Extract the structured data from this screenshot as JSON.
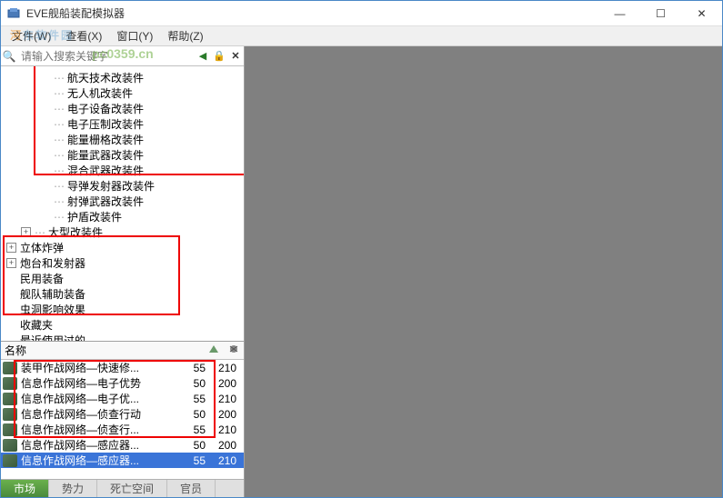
{
  "window": {
    "title": "EVE舰船装配模拟器",
    "minimize": "—",
    "maximize": "☐",
    "close": "✕"
  },
  "menu": {
    "file": "文件(W)",
    "view": "查看(X)",
    "window": "窗口(Y)",
    "help": "帮助(Z)"
  },
  "watermark": {
    "main_a": "河",
    "main_b": "东软件园",
    "url": "pc0359.cn"
  },
  "search": {
    "placeholder": "请输入搜索关键字"
  },
  "toolbar": {
    "left": "◀",
    "lock": "🔒",
    "close": "✕"
  },
  "tree": [
    {
      "indent": 2,
      "label": "航天技术改装件",
      "expander": ""
    },
    {
      "indent": 2,
      "label": "无人机改装件",
      "expander": ""
    },
    {
      "indent": 2,
      "label": "电子设备改装件",
      "expander": ""
    },
    {
      "indent": 2,
      "label": "电子压制改装件",
      "expander": ""
    },
    {
      "indent": 2,
      "label": "能量栅格改装件",
      "expander": ""
    },
    {
      "indent": 2,
      "label": "能量武器改装件",
      "expander": ""
    },
    {
      "indent": 2,
      "label": "混合武器改装件",
      "expander": ""
    },
    {
      "indent": 2,
      "label": "导弹发射器改装件",
      "expander": ""
    },
    {
      "indent": 2,
      "label": "射弹武器改装件",
      "expander": ""
    },
    {
      "indent": 2,
      "label": "护盾改装件",
      "expander": ""
    },
    {
      "indent": 1,
      "label": "大型改装件",
      "expander": "+"
    },
    {
      "indent": 0,
      "label": "立体炸弹",
      "expander": "+"
    },
    {
      "indent": 0,
      "label": "炮台和发射器",
      "expander": "+"
    },
    {
      "indent": 0,
      "label": "民用装备",
      "expander": ""
    },
    {
      "indent": 0,
      "label": "舰队辅助装备",
      "expander": ""
    },
    {
      "indent": 0,
      "label": "虫洞影响效果",
      "expander": ""
    },
    {
      "indent": 0,
      "label": "收藏夹",
      "expander": ""
    },
    {
      "indent": 0,
      "label": "最近使用过的",
      "expander": ""
    }
  ],
  "itemHeader": {
    "name": "名称"
  },
  "items": [
    {
      "name": "装甲作战网络—快速修...",
      "c1": "55",
      "c2": "210",
      "selected": false
    },
    {
      "name": "信息作战网络—电子优势",
      "c1": "50",
      "c2": "200",
      "selected": false
    },
    {
      "name": "信息作战网络—电子优...",
      "c1": "55",
      "c2": "210",
      "selected": false
    },
    {
      "name": "信息作战网络—侦查行动",
      "c1": "50",
      "c2": "200",
      "selected": false
    },
    {
      "name": "信息作战网络—侦查行...",
      "c1": "55",
      "c2": "210",
      "selected": false
    },
    {
      "name": "信息作战网络—感应器...",
      "c1": "50",
      "c2": "200",
      "selected": false
    },
    {
      "name": "信息作战网络—感应器...",
      "c1": "55",
      "c2": "210",
      "selected": true
    }
  ],
  "tabs": {
    "market": "市场",
    "power": "势力",
    "deadspace": "死亡空间",
    "officer": "官员"
  }
}
